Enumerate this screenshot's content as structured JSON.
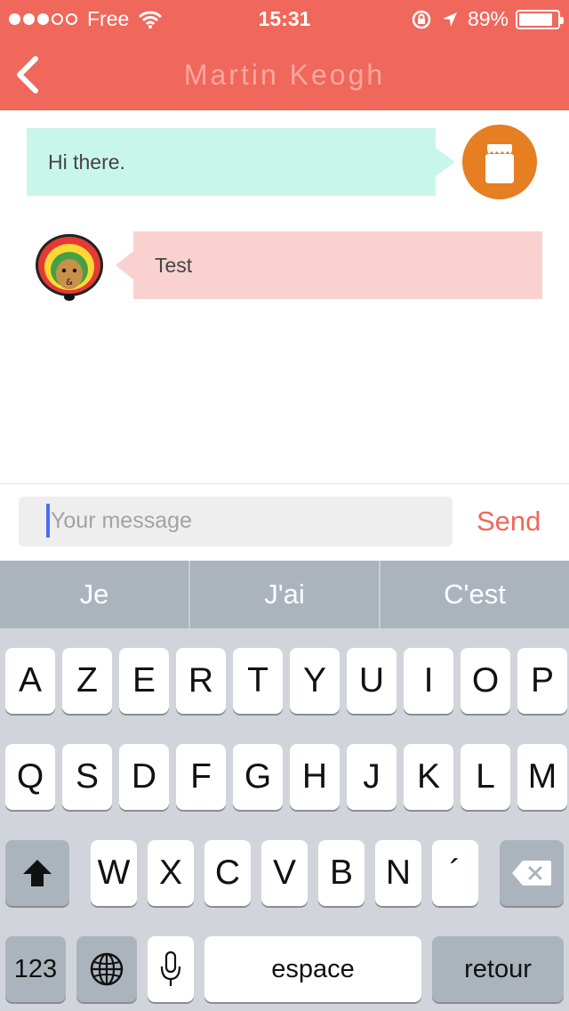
{
  "status_bar": {
    "carrier": "Free",
    "time": "15:31",
    "battery": "89%",
    "battery_level": 0.89,
    "signal_bars_filled": 3,
    "signal_bars_total": 5
  },
  "nav": {
    "title": "Martin Keogh",
    "back_icon": "chevron-left-icon"
  },
  "messages": [
    {
      "direction": "outgoing",
      "text": "Hi there.",
      "avatar_icon": "jar-icon"
    },
    {
      "direction": "incoming",
      "text": "Test",
      "avatar_icon": "rasta-character-icon"
    }
  ],
  "composer": {
    "placeholder": "Your message",
    "send_label": "Send"
  },
  "keyboard": {
    "suggestions": [
      "Je",
      "J'ai",
      "C'est"
    ],
    "row1": [
      "A",
      "Z",
      "E",
      "R",
      "T",
      "Y",
      "U",
      "I",
      "O",
      "P"
    ],
    "row2": [
      "Q",
      "S",
      "D",
      "F",
      "G",
      "H",
      "J",
      "K",
      "L",
      "M"
    ],
    "row3": [
      "W",
      "X",
      "C",
      "V",
      "B",
      "N",
      "´"
    ],
    "numbers_label": "123",
    "space_label": "espace",
    "return_label": "retour"
  },
  "colors": {
    "accent": "#f0675c",
    "outgoing_bubble": "#c9f6eb",
    "incoming_bubble": "#f9d2d0",
    "jar_avatar": "#e67e22"
  }
}
